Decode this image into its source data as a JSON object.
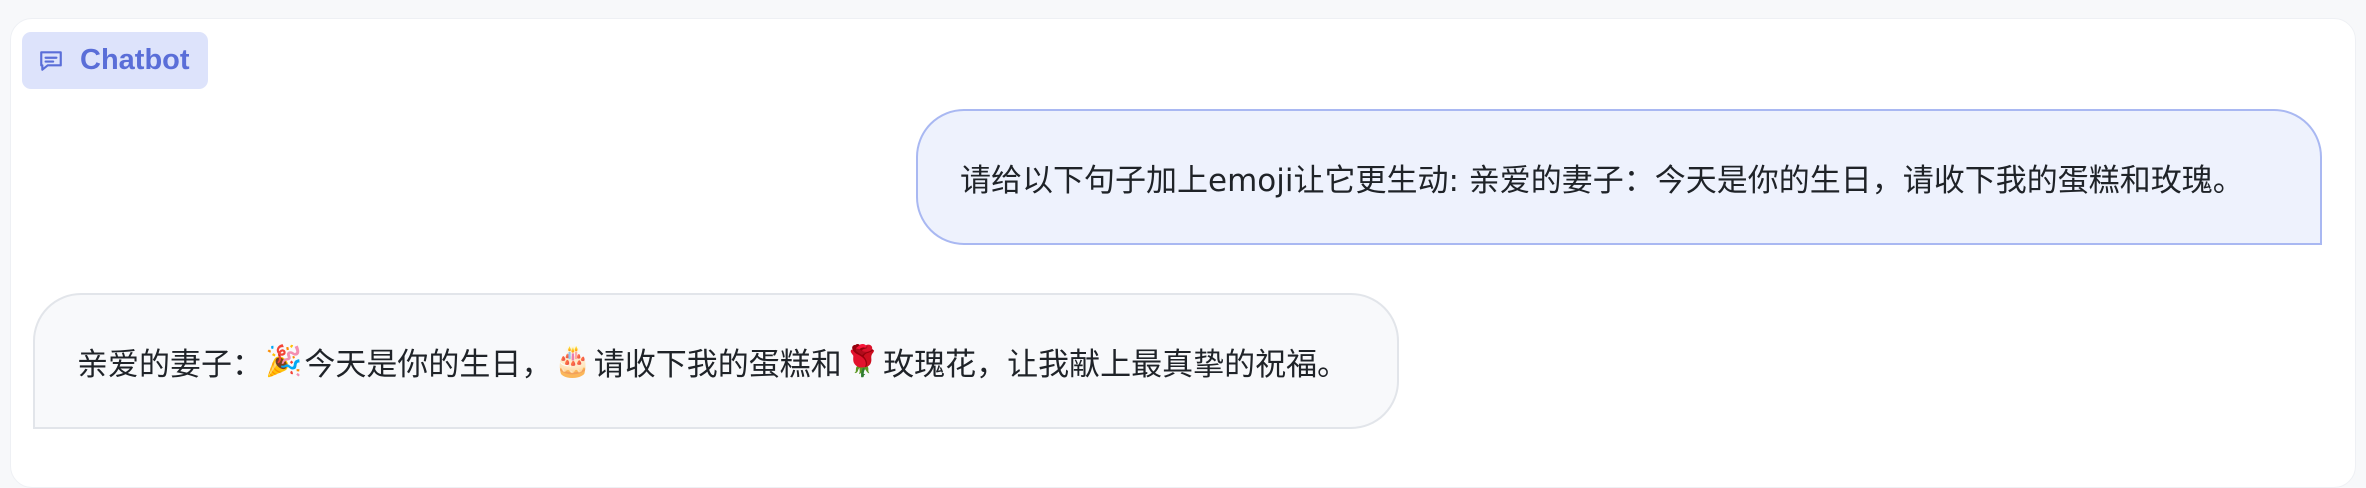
{
  "chat": {
    "label": "Chatbot",
    "messages": [
      {
        "role": "user",
        "text": "请给以下句子加上emoji让它更生动: 亲爱的妻子：今天是你的生日，请收下我的蛋糕和玫瑰。"
      },
      {
        "role": "bot",
        "parts": {
          "p1": "亲爱的妻子：",
          "emoji1": "🎉",
          "p2": "今天是你的生日，",
          "emoji2": "🎂",
          "p3": "请收下我的蛋糕和",
          "emoji3": "🌹",
          "p4": "玫瑰花，让我献上最真挚的祝福。"
        }
      }
    ]
  },
  "colors": {
    "accent": "#5a6ed8",
    "chip_bg": "#dde3fb",
    "user_bubble_bg": "#eef2fd",
    "user_bubble_border": "#a9b8f2",
    "bot_bubble_bg": "#f8f9fb",
    "bot_bubble_border": "#e2e5ea"
  },
  "icons": {
    "chip_icon": "chat-bubble-icon"
  }
}
